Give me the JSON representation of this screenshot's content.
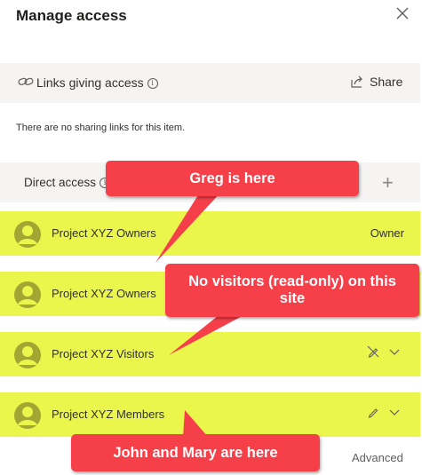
{
  "header": {
    "title": "Manage access",
    "close_icon": "close-icon"
  },
  "links": {
    "label": "Links giving access",
    "share_label": "Share",
    "empty_message": "There are no sharing links for this item."
  },
  "direct": {
    "label": "Direct access",
    "add_icon": "plus-icon"
  },
  "members": [
    {
      "name": "Project XYZ Owners",
      "role": "Owner"
    },
    {
      "name": "Project XYZ Owners",
      "role": ""
    },
    {
      "name": "Project XYZ Visitors",
      "role": "",
      "permission_icon": "no-edit-icon"
    },
    {
      "name": "Project XYZ Members",
      "role": "",
      "permission_icon": "pencil-icon"
    }
  ],
  "footer": {
    "advanced_label": "Advanced"
  },
  "callouts": [
    {
      "text": "Greg is here"
    },
    {
      "text": "No visitors (read-only) on this site"
    },
    {
      "text": "John and Mary are here"
    }
  ],
  "colors": {
    "highlight": "#eaf64c",
    "callout": "#f5404a",
    "panel": "#f5f4f3",
    "avatar": "#a3a632"
  }
}
